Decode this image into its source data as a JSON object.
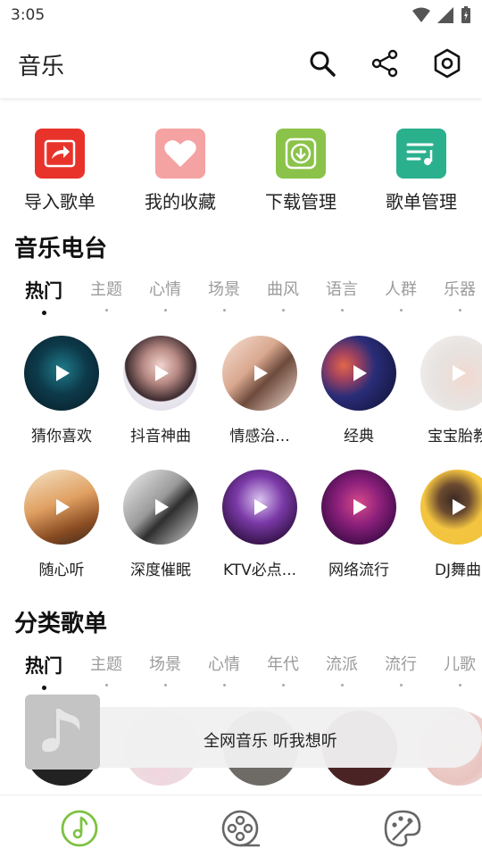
{
  "status": {
    "time": "3:05"
  },
  "appbar": {
    "title": "音乐"
  },
  "quick": [
    {
      "label": "导入歌单",
      "icon": "import-icon",
      "color": "#E8332B"
    },
    {
      "label": "我的收藏",
      "icon": "heart-icon",
      "color": "#F5A2A2"
    },
    {
      "label": "下载管理",
      "icon": "download-icon",
      "color": "#8BC34A"
    },
    {
      "label": "歌单管理",
      "icon": "playlist-icon",
      "color": "#2BB08E"
    }
  ],
  "radio": {
    "title": "音乐电台",
    "tabs": [
      "热门",
      "主题",
      "心情",
      "场景",
      "曲风",
      "语言",
      "人群",
      "乐器"
    ],
    "row1": [
      "猜你喜欢",
      "抖音神曲",
      "情感治...",
      "经典",
      "宝宝胎教"
    ],
    "row2": [
      "随心听",
      "深度催眠",
      "KTV必点...",
      "网络流行",
      "DJ舞曲"
    ]
  },
  "playlists": {
    "title": "分类歌单",
    "tabs": [
      "热门",
      "主题",
      "场景",
      "心情",
      "年代",
      "流派",
      "流行",
      "儿歌"
    ]
  },
  "toast": {
    "text": "全网音乐 听我想听"
  },
  "nav": [
    {
      "icon": "music-note-icon",
      "color": "#7CC242"
    },
    {
      "icon": "film-reel-icon",
      "color": "#666666"
    },
    {
      "icon": "palette-icon",
      "color": "#666666"
    }
  ]
}
